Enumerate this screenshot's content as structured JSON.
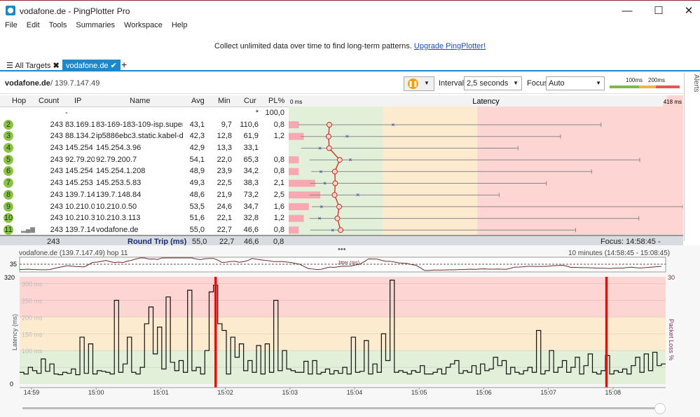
{
  "window": {
    "title": "vodafone.de - PingPlotter Pro",
    "min": "—",
    "max": "☐",
    "close": "✕"
  },
  "menu": [
    "File",
    "Edit",
    "Tools",
    "Summaries",
    "Workspace",
    "Help"
  ],
  "banner": {
    "text": "Collect unlimited data over time to find long-term patterns.",
    "link": "Upgrade PingPlotter!"
  },
  "tabs": {
    "all": "All Targets",
    "active": "vodafone.de",
    "add": "+"
  },
  "target": {
    "name": "vodafone.de",
    "ip": "/ 139.7.147.49",
    "interval_label": "Interval",
    "interval": "2,5 seconds",
    "focus_label": "Focus",
    "focus": "Auto",
    "legend_100": "100ms",
    "legend_200": "200ms",
    "alerts": "Alerts"
  },
  "table": {
    "headers": [
      "Hop",
      "Count",
      "IP",
      "Name",
      "Avg",
      "Min",
      "Cur",
      "PL%"
    ],
    "latency_header": "Latency",
    "scale_min": "0 ms",
    "scale_max": "418 ms",
    "scale_max_value": 418,
    "rows": [
      {
        "hop": "",
        "count": "",
        "ip": "-",
        "name": "",
        "avg": "",
        "min": "",
        "cur": "*",
        "pl": "100,0"
      },
      {
        "hop": "2",
        "count": "243",
        "ip": "83.169.1",
        "name": "83-169-183-109-isp.superk",
        "avg": "43,1",
        "min": "9,7",
        "cur": "110,6",
        "pl": "0,8",
        "a": 43.1,
        "mn": 9.7,
        "c": 110.6,
        "mx": 331,
        "p": 0.8
      },
      {
        "hop": "3",
        "count": "243",
        "ip": "88.134.2",
        "name": "ip5886ebc3.static.kabel-deu",
        "avg": "42,3",
        "min": "12,8",
        "cur": "61,9",
        "pl": "1,2",
        "a": 42.3,
        "mn": 12.8,
        "c": 61.9,
        "mx": 288,
        "p": 1.2
      },
      {
        "hop": "4",
        "count": "243",
        "ip": "145.254",
        "name": "145.254.3.96",
        "avg": "42,9",
        "min": "13,3",
        "cur": "33,1",
        "pl": "",
        "a": 42.9,
        "mn": 13.3,
        "c": 33.1,
        "mx": 243,
        "p": 0
      },
      {
        "hop": "5",
        "count": "243",
        "ip": "92.79.20",
        "name": "92.79.200.7",
        "avg": "54,1",
        "min": "22,0",
        "cur": "65,3",
        "pl": "0,8",
        "a": 54.1,
        "mn": 22,
        "c": 65.3,
        "mx": 372,
        "p": 0.8
      },
      {
        "hop": "6",
        "count": "243",
        "ip": "145.254",
        "name": "145.254.1.208",
        "avg": "48,9",
        "min": "23,9",
        "cur": "34,2",
        "pl": "0,8",
        "a": 48.9,
        "mn": 23.9,
        "c": 34.2,
        "mx": 321,
        "p": 0.8
      },
      {
        "hop": "7",
        "count": "243",
        "ip": "145.253",
        "name": "145.253.5.83",
        "avg": "49,3",
        "min": "22,5",
        "cur": "38,3",
        "pl": "2,1",
        "a": 49.3,
        "mn": 22.5,
        "c": 38.3,
        "mx": 273,
        "p": 2.1
      },
      {
        "hop": "8",
        "count": "243",
        "ip": "139.7.14",
        "name": "139.7.148.84",
        "avg": "48,6",
        "min": "21,9",
        "cur": "73,2",
        "pl": "2,5",
        "a": 48.6,
        "mn": 21.9,
        "c": 73.2,
        "mx": 223,
        "p": 2.5
      },
      {
        "hop": "9",
        "count": "243",
        "ip": "10.210.0",
        "name": "10.210.0.50",
        "avg": "53,5",
        "min": "24,6",
        "cur": "34,7",
        "pl": "1,6",
        "a": 53.5,
        "mn": 24.6,
        "c": 34.7,
        "mx": 418,
        "p": 1.6
      },
      {
        "hop": "10",
        "count": "243",
        "ip": "10.210.3",
        "name": "10.210.3.113",
        "avg": "51,6",
        "min": "22,1",
        "cur": "32,8",
        "pl": "1,2",
        "a": 51.6,
        "mn": 22.1,
        "c": 32.8,
        "mx": 371,
        "p": 1.2
      },
      {
        "hop": "11",
        "count": "243",
        "ip": "139.7.14",
        "name": "vodafone.de",
        "avg": "55,0",
        "min": "22,7",
        "cur": "46,6",
        "pl": "0,8",
        "a": 55,
        "mn": 22.7,
        "c": 46.6,
        "mx": 304,
        "p": 0.8
      }
    ],
    "roundtrip": {
      "count": "243",
      "label": "Round Trip (ms)",
      "avg": "55,0",
      "min": "22,7",
      "cur": "46,6",
      "pl": "0,8",
      "focus": "Focus: 14:58:45 - 15:08:45"
    }
  },
  "graph": {
    "title": "vodafone.de (139.7.147.49) hop 11",
    "range": "10 minutes (14:58:45 - 15:08:45)",
    "jitter_label": "Jitter (ms)",
    "jitter_tick": "35",
    "ylabel": "Latency (ms)",
    "y2label": "Packet Loss %",
    "ymax": "320",
    "ymin": "0",
    "y2max": "30",
    "bands": [
      "300 ms",
      "250 ms",
      "200 ms",
      "150 ms",
      "100 ms"
    ],
    "xticks": [
      "14:59",
      "15:00",
      "15:01",
      "15:02",
      "15:03",
      "15:04",
      "15:05",
      "15:06",
      "15:07",
      "15:08"
    ]
  },
  "chart_data": {
    "type": "line",
    "ylim": [
      0,
      320
    ],
    "loss_events_minutes": [
      2.85,
      8.9
    ],
    "latency": [
      35,
      30,
      50,
      40,
      32,
      75,
      38,
      60,
      30,
      28,
      35,
      32,
      45,
      28,
      140,
      32,
      120,
      30,
      40,
      38,
      35,
      30,
      250,
      35,
      60,
      140,
      35,
      30,
      50,
      180,
      230,
      90,
      170,
      45,
      260,
      65,
      40,
      70,
      35,
      280,
      40,
      50,
      30,
      100,
      275,
      295,
      180,
      160,
      30,
      140,
      80,
      120,
      40,
      70,
      35,
      115,
      30,
      120,
      35,
      250,
      40,
      100,
      45,
      40,
      35,
      35,
      68,
      30,
      70,
      30,
      35,
      45,
      30,
      40,
      32,
      50,
      30,
      140,
      35,
      38,
      130,
      30,
      60,
      35,
      150,
      70,
      310,
      35,
      40,
      35,
      30,
      40,
      35,
      55,
      30,
      30,
      35,
      45,
      30,
      50,
      60,
      70,
      32,
      40,
      35,
      55,
      30,
      60,
      40,
      45,
      80,
      55,
      70,
      30,
      50,
      35,
      30,
      40,
      50,
      35,
      160,
      30,
      40,
      100,
      35,
      50,
      70,
      35,
      50,
      80,
      30,
      55,
      90,
      35,
      30,
      40,
      85,
      30,
      40,
      35,
      45,
      30,
      55,
      80,
      35,
      90,
      40,
      95,
      55,
      60
    ]
  }
}
